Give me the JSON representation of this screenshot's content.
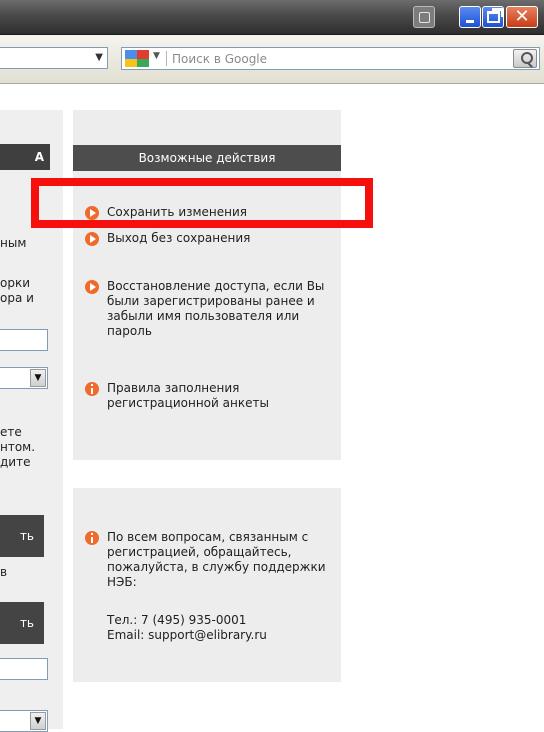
{
  "window": {
    "minimize": "minimize",
    "restore": "restore",
    "close": "close"
  },
  "toolbar": {
    "search_placeholder": "Поиск в Google"
  },
  "left": {
    "header_fragment": "А",
    "text1": "ным",
    "text2": "орки",
    "text3": "ора и",
    "text4": "ете",
    "text5": "нтом.",
    "text6": "дите",
    "button1": "ть",
    "text7": "в",
    "button2": "ть"
  },
  "actions": {
    "header": "Возможные действия",
    "items": [
      {
        "label": "Сохранить изменения",
        "icon": "play-icon"
      },
      {
        "label": "Выход без сохранения",
        "icon": "play-icon"
      },
      {
        "label": "Восстановление доступа, если Вы были зарегистрированы ранее и забыли имя пользователя или пароль",
        "icon": "play-icon"
      },
      {
        "label": "Правила заполнения регистрационной анкеты",
        "icon": "info-icon"
      }
    ]
  },
  "support": {
    "text": "По всем вопросам, связанным с регистрацией, обращайтесь, пожалуйста, в службу поддержки НЭБ:",
    "phone": "Тел.: 7 (495) 935-0001",
    "email": "Email: support@elibrary.ru",
    "icon": "info-icon"
  },
  "colors": {
    "highlight": "#f5100e",
    "bullet": "#ef6b2b",
    "header_bg": "#4d4d4d",
    "panel_bg": "#ededed"
  }
}
